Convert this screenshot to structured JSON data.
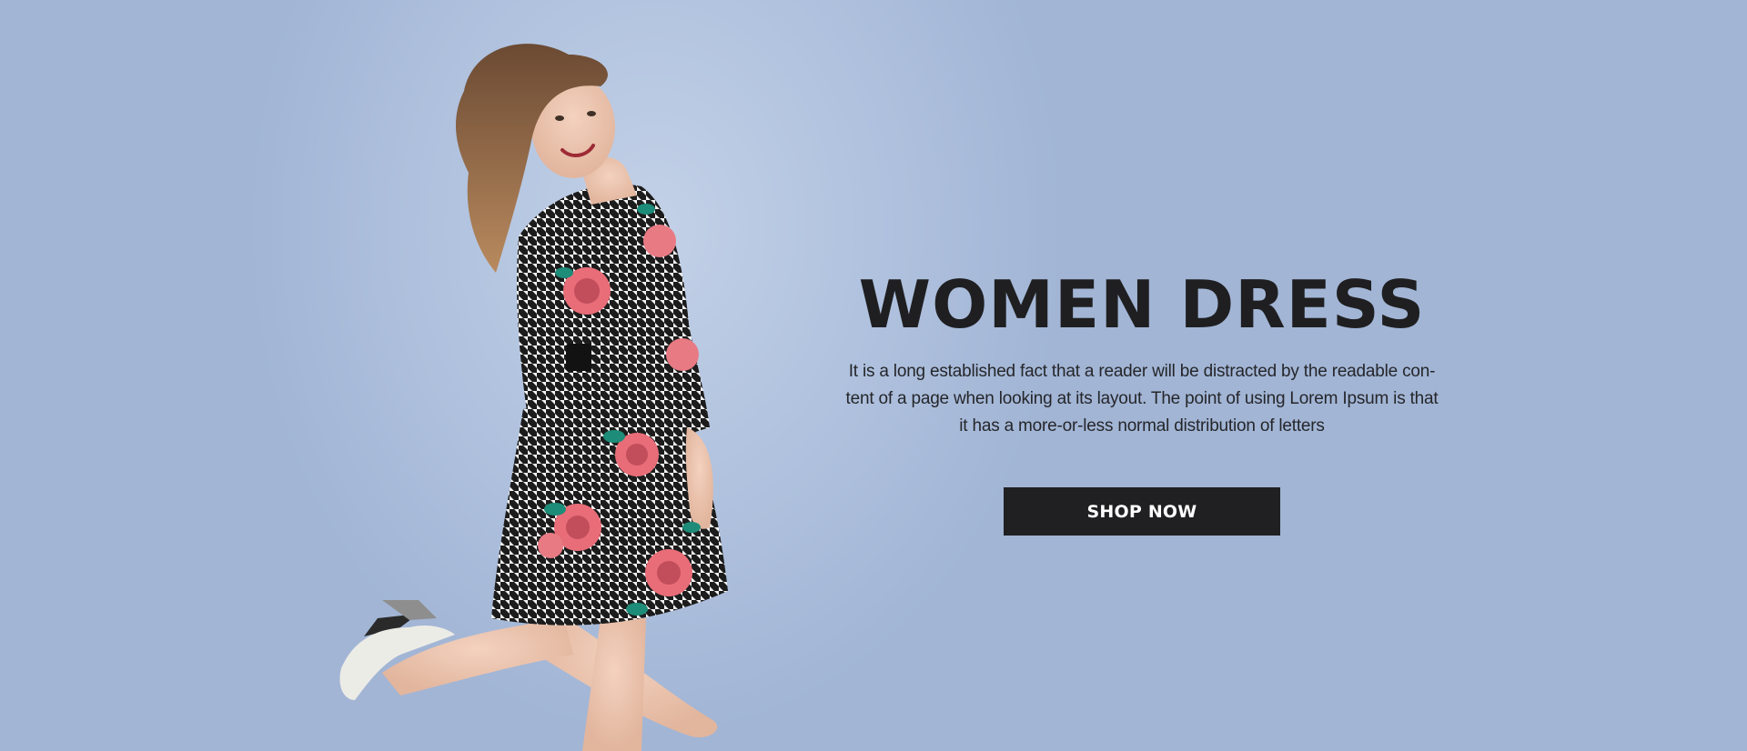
{
  "hero": {
    "title": "WOMEN DRESS",
    "description": "It is a long established fact that a reader will be distracted by the readable con-tent of a page when looking at its layout. The point of using Lorem Ipsum is that it has a more-or-less normal distribution of letters",
    "button_label": "SHOP NOW",
    "photo_alt": "Smiling woman in houndstooth floral dress kicking one leg up"
  },
  "colors": {
    "background": "#a2b5d5",
    "text": "#1f1f21",
    "button_bg": "#202022",
    "button_text": "#ffffff"
  }
}
